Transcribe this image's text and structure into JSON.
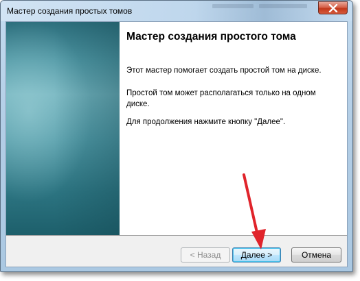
{
  "window": {
    "title": "Мастер создания простых томов"
  },
  "content": {
    "heading": "Мастер создания простого тома",
    "paragraphs": [
      "Этот мастер помогает создать простой том на диске.",
      "Простой том может располагаться только на одном диске.",
      "Для продолжения нажмите кнопку \"Далее\"."
    ]
  },
  "buttons": {
    "back_label": "< Назад",
    "next_label": "Далее >",
    "cancel_label": "Отмена"
  },
  "colors": {
    "annotation_arrow": "#e0242b",
    "side_panel": "#4e96a3",
    "close_button": "#c2391c"
  },
  "icons": {
    "close": "close-icon"
  }
}
